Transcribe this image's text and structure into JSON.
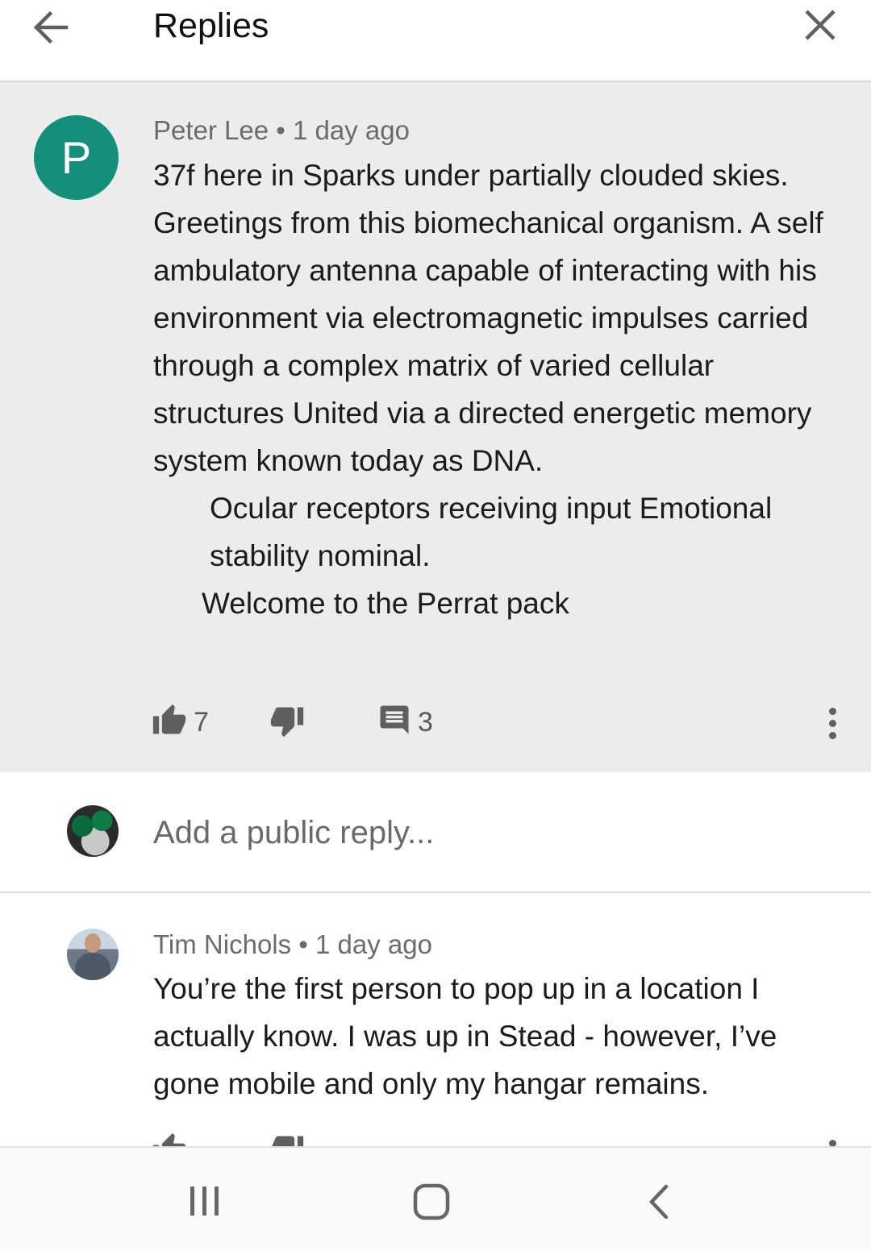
{
  "header": {
    "title": "Replies",
    "back_icon": "arrow-left-icon",
    "close_icon": "close-icon"
  },
  "parent_comment": {
    "avatar_letter": "P",
    "avatar_color": "#14907a",
    "author": "Peter Lee",
    "separator": "•",
    "time": "1 day ago",
    "paragraphs": [
      "37f here in Sparks under partially clouded skies.  Greetings from this biomechanical organism. A self ambulatory antenna capable of interacting with his environment via electromagnetic impulses carried through a complex matrix of varied cellular structures United via a directed energetic memory system known today as DNA.",
      "Ocular receptors receiving input Emotional stability nominal.",
      "Welcome to the Perrat pack"
    ],
    "like_count": "7",
    "reply_count": "3"
  },
  "reply_box": {
    "placeholder": "Add a public reply..."
  },
  "replies": [
    {
      "author": "Tim Nichols",
      "separator": "•",
      "time": "1 day ago",
      "text": "You’re the first person to pop up in a location I actually know. I was up in Stead - however, I’ve gone mobile and only my hangar remains."
    }
  ],
  "navbar": {
    "recent_icon": "recent-apps-icon",
    "home_icon": "home-icon",
    "back_icon": "nav-back-icon"
  },
  "colors": {
    "parent_bg": "#ececec",
    "meta_text": "#6b6b6b",
    "icon_gray": "#5f5f5f"
  }
}
